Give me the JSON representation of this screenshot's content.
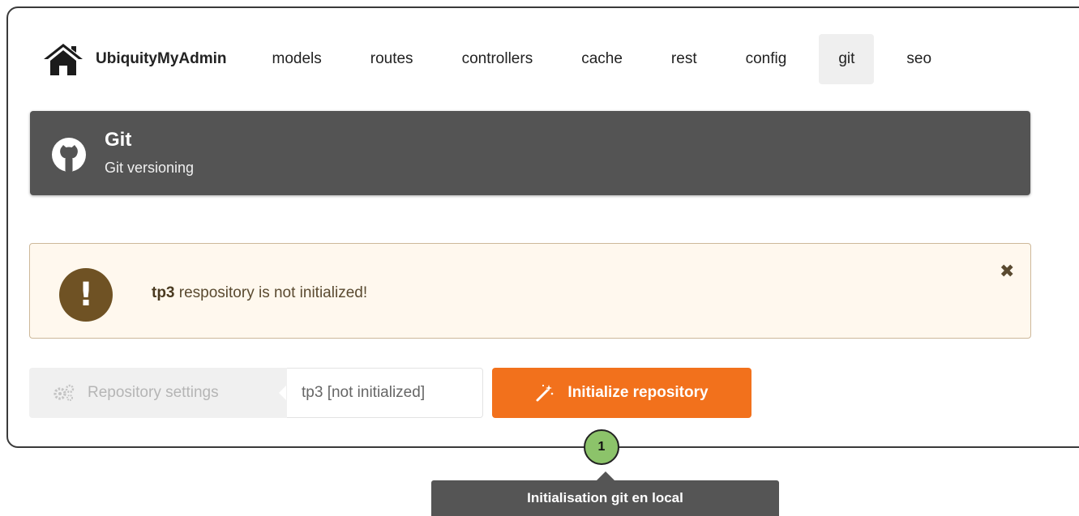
{
  "nav": {
    "brand_icon": "home-icon",
    "brand_label": "UbiquityMyAdmin",
    "items": [
      {
        "label": "models"
      },
      {
        "label": "routes"
      },
      {
        "label": "controllers"
      },
      {
        "label": "cache"
      },
      {
        "label": "rest"
      },
      {
        "label": "config"
      },
      {
        "label": "git",
        "active": true
      },
      {
        "label": "seo"
      }
    ]
  },
  "header": {
    "icon": "github-icon",
    "title": "Git",
    "subtitle": "Git versioning",
    "background": "#545454"
  },
  "message": {
    "icon": "exclamation-icon",
    "repo_name": "tp3",
    "text": " respository is not initialized!",
    "close_icon": "close-icon",
    "background": "#fff8ee"
  },
  "actions": {
    "settings_icon": "gears-icon",
    "settings_label": "Repository settings",
    "repo_label": "tp3 [not initialized]",
    "init_icon": "magic-wand-icon",
    "init_label": "Initialize repository",
    "init_color": "#f2711c"
  },
  "annotation": {
    "step_number": "1",
    "tooltip": "Initialisation git en local",
    "badge_color": "#8cc36a"
  }
}
